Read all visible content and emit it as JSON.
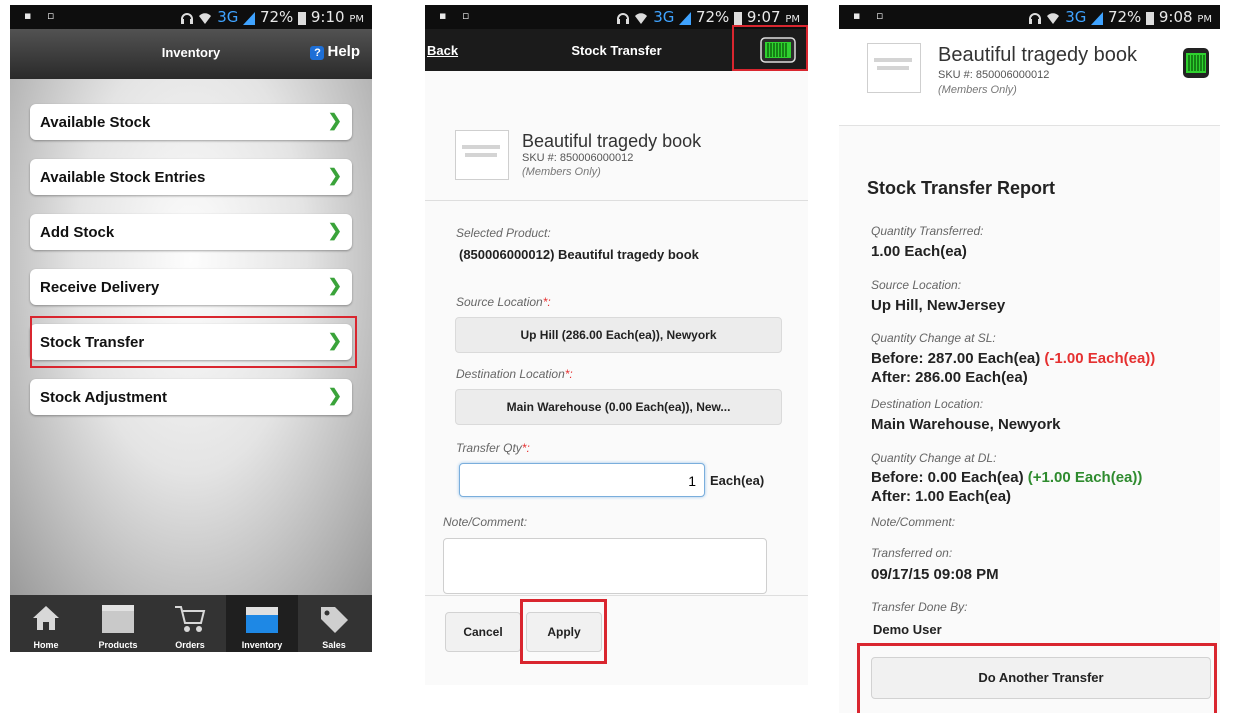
{
  "screen1": {
    "status": {
      "left": "▪ ▫",
      "net": "3G",
      "battery": "72%",
      "time": "9:10",
      "ampm": "PM"
    },
    "header": {
      "title": "Inventory",
      "help": "Help"
    },
    "menu": [
      {
        "label": "Available Stock"
      },
      {
        "label": "Available Stock Entries"
      },
      {
        "label": "Add Stock"
      },
      {
        "label": "Receive Delivery"
      },
      {
        "label": "Stock Transfer"
      },
      {
        "label": "Stock Adjustment"
      }
    ],
    "tabs": [
      {
        "label": "Home",
        "icon": "home-icon"
      },
      {
        "label": "Products",
        "icon": "products-icon"
      },
      {
        "label": "Orders",
        "icon": "orders-icon"
      },
      {
        "label": "Inventory",
        "icon": "inventory-icon"
      },
      {
        "label": "Sales",
        "icon": "sales-icon"
      }
    ]
  },
  "screen2": {
    "status": {
      "left": "▪ ▫",
      "net": "3G",
      "battery": "72%",
      "time": "9:07",
      "ampm": "PM"
    },
    "header": {
      "back": "Back",
      "title": "Stock Transfer"
    },
    "product": {
      "name": "Beautiful tragedy book",
      "sku": "SKU #: 850006000012",
      "note": "(Members Only)"
    },
    "selected_product_label": "Selected Product:",
    "selected_product_value": "(850006000012) Beautiful tragedy book",
    "source_label": "Source Location",
    "source_value": "Up Hill (286.00 Each(ea)), Newyork",
    "destination_label": "Destination Location",
    "destination_value": "Main Warehouse (0.00 Each(ea)), New...",
    "qty_label": "Transfer Qty",
    "qty_value": "1",
    "qty_unit": "Each(ea)",
    "required_mark": "*:",
    "note_label": "Note/Comment:",
    "cancel": "Cancel",
    "apply": "Apply"
  },
  "screen3": {
    "status": {
      "left": "▪ ▫",
      "net": "3G",
      "battery": "72%",
      "time": "9:08",
      "ampm": "PM"
    },
    "product": {
      "name": "Beautiful tragedy book",
      "sku": "SKU #: 850006000012",
      "note": "(Members Only)"
    },
    "report_title": "Stock Transfer Report",
    "qty_transferred_label": "Quantity Transferred:",
    "qty_transferred_value": "1.00 Each(ea)",
    "source_label": "Source Location:",
    "source_value": "Up Hill, NewJersey",
    "sl_change_label": "Quantity Change at SL:",
    "sl_before": "Before: 287.00 Each(ea)",
    "sl_delta": "(-1.00 Each(ea))",
    "sl_after": "After: 286.00 Each(ea)",
    "destination_label": "Destination Location:",
    "destination_value": "Main Warehouse, Newyork",
    "dl_change_label": "Quantity Change at DL:",
    "dl_before": "Before: 0.00 Each(ea)",
    "dl_delta": "(+1.00 Each(ea))",
    "dl_after": "After: 1.00 Each(ea)",
    "note_label": "Note/Comment:",
    "transferred_on_label": "Transferred on:",
    "transferred_on_value": "09/17/15 09:08 PM",
    "done_by_label": "Transfer Done By:",
    "done_by_value": "Demo User",
    "another_button": "Do Another Transfer"
  },
  "colors": {
    "highlight": "#d9262f",
    "accent_green": "#3aa33a",
    "negative": "#e53030",
    "positive": "#2e8b2e",
    "network": "#3fa3ff"
  }
}
